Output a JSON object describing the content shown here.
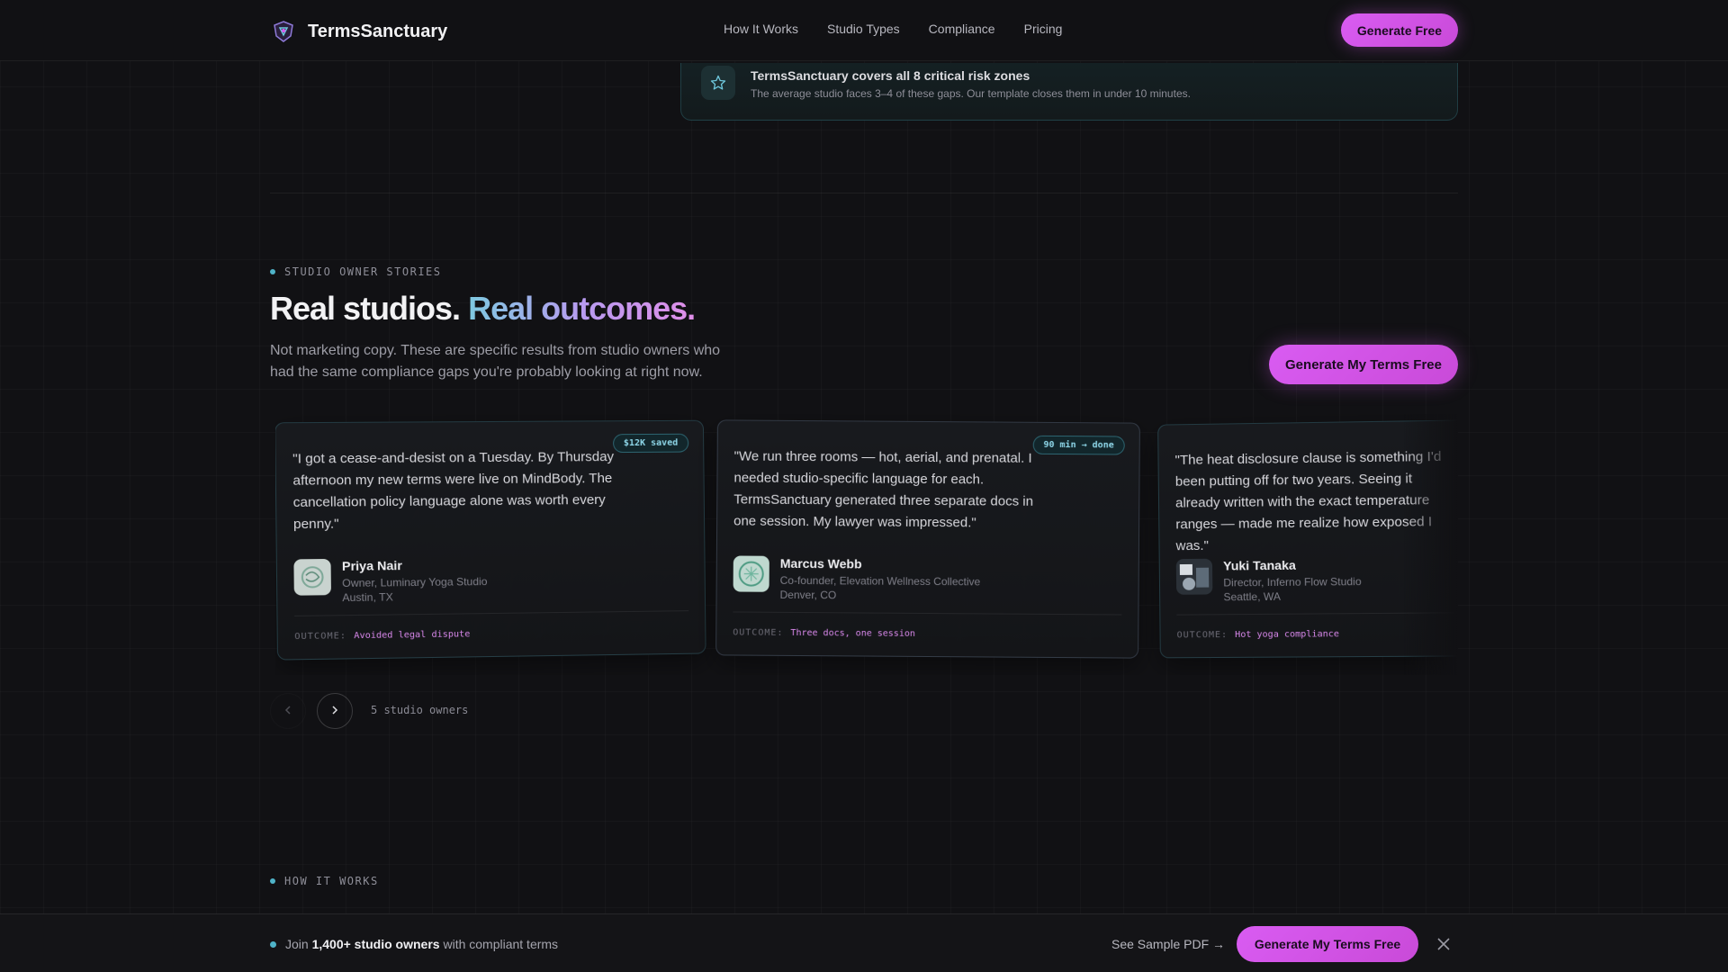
{
  "nav": {
    "brand": "TermsSanctuary",
    "links": [
      "How It Works",
      "Studio Types",
      "Compliance",
      "Pricing"
    ],
    "cta": "Generate Free"
  },
  "banner": {
    "title": "TermsSanctuary covers all 8 critical risk zones",
    "subtitle": "The average studio faces 3–4 of these gaps. Our template closes them in under 10 minutes."
  },
  "stories": {
    "eyebrow": "STUDIO OWNER STORIES",
    "title_plain": "Real studios.",
    "title_accent": "Real outcomes.",
    "lede": "Not marketing copy. These are specific results from studio owners who had the same compliance gaps you're probably looking at right now.",
    "cta": "Generate My Terms Free",
    "outcome_label": "OUTCOME:",
    "count_label": "5 studio owners",
    "cards": [
      {
        "quote": "\"I got a cease-and-desist on a Tuesday. By Thursday afternoon my new terms were live on MindBody. The cancellation policy language alone was worth every penny.\"",
        "badge": "$12K saved",
        "name": "Priya Nair",
        "role": "Owner, Luminary Yoga Studio",
        "location": "Austin, TX",
        "outcome": "Avoided legal dispute"
      },
      {
        "quote": "\"We run three rooms — hot, aerial, and prenatal. I needed studio-specific language for each. TermsSanctuary generated three separate docs in one session. My lawyer was impressed.\"",
        "badge": "90 min → done",
        "name": "Marcus Webb",
        "role": "Co-founder, Elevation Wellness Collective",
        "location": "Denver, CO",
        "outcome": "Three docs, one session"
      },
      {
        "quote": "\"The heat disclosure clause is something I'd been putting off for two years. Seeing it already written with the exact temperature ranges — made me realize how exposed I was.\"",
        "badge": "",
        "name": "Yuki Tanaka",
        "role": "Director, Inferno Flow Studio",
        "location": "Seattle, WA",
        "outcome": "Hot yoga compliance"
      }
    ]
  },
  "how_it_works": {
    "eyebrow": "HOW IT WORKS"
  },
  "bottom_bar": {
    "prefix": "Join",
    "highlight": "1,400+ studio owners",
    "suffix": "with compliant terms",
    "sample_link": "See Sample PDF →",
    "cta": "Generate My Terms Free"
  },
  "icons": {
    "brand": "shield-logo-icon",
    "banner": "star-icon",
    "prev": "chevron-left-icon",
    "next": "chevron-right-icon",
    "close": "close-icon"
  },
  "colors": {
    "accent": "#d95cf2",
    "teal": "#4fb3c8",
    "background": "#111114"
  }
}
